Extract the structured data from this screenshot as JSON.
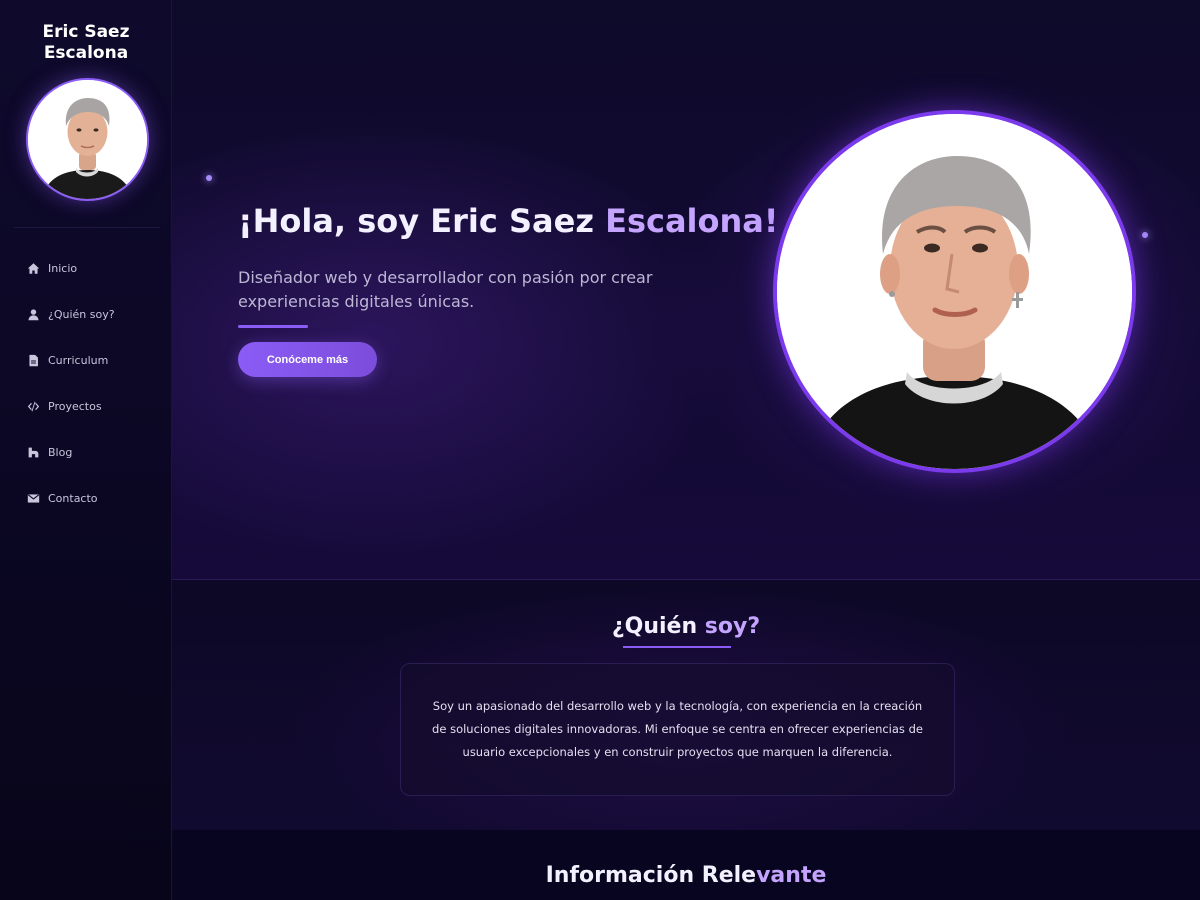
{
  "sidebar": {
    "name_line1": "Eric Saez",
    "name_line2": "Escalona",
    "items": [
      {
        "label": "Inicio",
        "icon": "home-icon"
      },
      {
        "label": "¿Quién soy?",
        "icon": "user-icon"
      },
      {
        "label": "Curriculum",
        "icon": "document-icon"
      },
      {
        "label": "Proyectos",
        "icon": "code-icon"
      },
      {
        "label": "Blog",
        "icon": "blog-icon"
      },
      {
        "label": "Contacto",
        "icon": "envelope-icon"
      }
    ]
  },
  "hero": {
    "title_main": "¡Hola, soy Eric Saez ",
    "title_accent": "Escalona!",
    "subtitle": "Diseñador web y desarrollador con pasión por crear experiencias digitales únicas.",
    "button_label": "Conóceme más"
  },
  "about": {
    "title_main": "¿Quién ",
    "title_accent": "soy?",
    "text": "Soy un apasionado del desarrollo web y la tecnología, con experiencia en la creación de soluciones digitales innovadoras. Mi enfoque se centra en ofrecer experiencias de usuario excepcionales y en construir proyectos que marquen la diferencia."
  },
  "info": {
    "title_main": "Información Rele",
    "title_accent": "vante"
  },
  "colors": {
    "accent": "#8b5cf6",
    "accent_light": "#c4a4ff",
    "background": "#0a0620"
  }
}
